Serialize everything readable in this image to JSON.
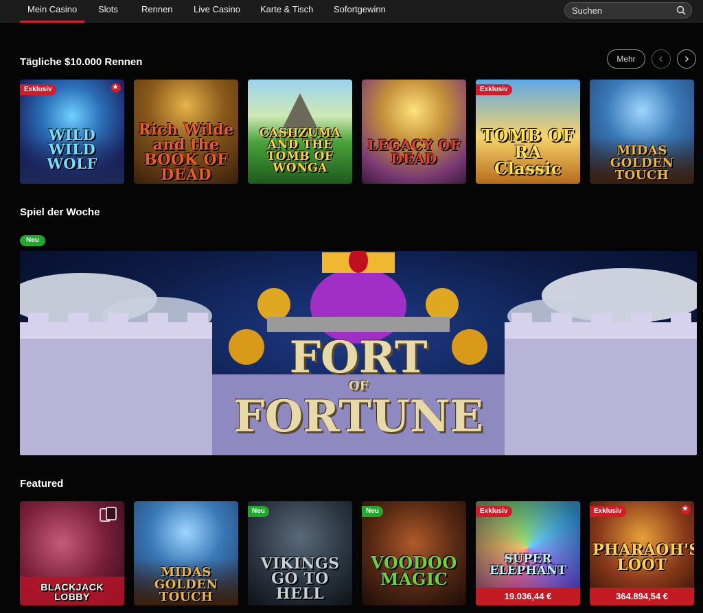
{
  "nav": {
    "items": [
      {
        "label": "Mein Casino",
        "active": true
      },
      {
        "label": "Slots",
        "active": false
      },
      {
        "label": "Rennen",
        "active": false
      },
      {
        "label": "Live Casino",
        "active": false
      },
      {
        "label": "Karte & Tisch",
        "active": false
      },
      {
        "label": "Sofortgewinn",
        "active": false
      }
    ],
    "search_placeholder": "Suchen",
    "accent": "#d9202e"
  },
  "races": {
    "title": "Tägliche $10.000 Rennen",
    "more_label": "Mehr",
    "prev_icon": "chevron-left-icon",
    "next_icon": "chevron-right-icon",
    "games": [
      {
        "name": "WILD WILD WOLF",
        "badge": "Exklusiv",
        "starred": true
      },
      {
        "name": "Rich Wilde and the BOOK OF DEAD",
        "badge": "",
        "starred": false
      },
      {
        "name": "CASHZUMA AND THE TOMB OF WONGA",
        "badge": "",
        "starred": false
      },
      {
        "name": "LEGACY OF DEAD",
        "badge": "",
        "starred": false
      },
      {
        "name": "TOMB OF RA Classic",
        "badge": "Exklusiv",
        "starred": false
      },
      {
        "name": "MIDAS GOLDEN TOUCH",
        "badge": "",
        "starred": false
      }
    ]
  },
  "game_of_week": {
    "title": "Spiel der Woche",
    "badge": "Neu",
    "hero_line1": "FORT",
    "hero_line2": "OF",
    "hero_line3": "FORTUNE"
  },
  "featured": {
    "title": "Featured",
    "games": [
      {
        "name": "BLACKJACK LOBBY",
        "badge": "",
        "jackpot": "",
        "starred": false
      },
      {
        "name": "MIDAS GOLDEN TOUCH",
        "badge": "",
        "jackpot": "",
        "starred": false
      },
      {
        "name": "VIKINGS GO TO HELL",
        "badge": "Neu",
        "jackpot": "",
        "starred": false
      },
      {
        "name": "VOODOO MAGIC",
        "badge": "Neu",
        "jackpot": "",
        "starred": false
      },
      {
        "name": "SUPER ELEPHANT",
        "badge": "Exklusiv",
        "jackpot": "19.036,44 €",
        "starred": false
      },
      {
        "name": "PHARAOH'S LOOT",
        "badge": "Exklusiv",
        "jackpot": "364.894,54 €",
        "starred": true
      }
    ]
  }
}
